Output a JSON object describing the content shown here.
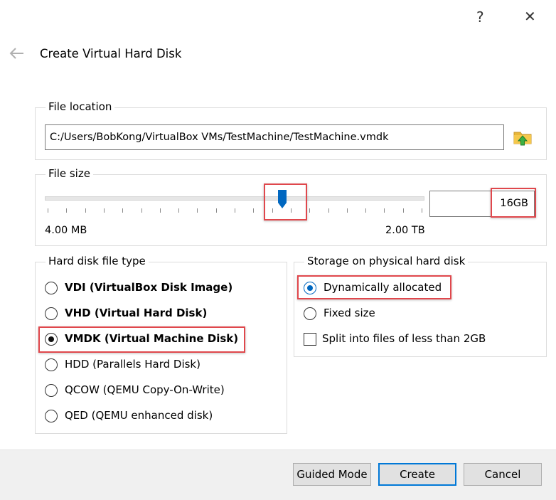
{
  "window": {
    "help_glyph": "?",
    "close_glyph": "✕",
    "title": "Create Virtual Hard Disk"
  },
  "file_location": {
    "group_label": "File location",
    "path": "C:/Users/BobKong/VirtualBox VMs/TestMachine/TestMachine.vmdk",
    "browse_icon": "folder-up-icon"
  },
  "file_size": {
    "group_label": "File size",
    "min_label": "4.00 MB",
    "max_label": "2.00 TB",
    "value": "16GB",
    "slider_fraction": 0.625
  },
  "disk_type": {
    "group_label": "Hard disk file type",
    "options": [
      {
        "label": "VDI (VirtualBox Disk Image)",
        "checked": false,
        "bold": true
      },
      {
        "label": "VHD (Virtual Hard Disk)",
        "checked": false,
        "bold": true
      },
      {
        "label": "VMDK (Virtual Machine Disk)",
        "checked": true,
        "bold": true
      },
      {
        "label": "HDD (Parallels Hard Disk)",
        "checked": false,
        "bold": false
      },
      {
        "label": "QCOW (QEMU Copy-On-Write)",
        "checked": false,
        "bold": false
      },
      {
        "label": "QED (QEMU enhanced disk)",
        "checked": false,
        "bold": false
      }
    ]
  },
  "storage": {
    "group_label": "Storage on physical hard disk",
    "dynamic_label": "Dynamically allocated",
    "fixed_label": "Fixed size",
    "split_label": "Split into files of less than 2GB",
    "dynamic_checked": true,
    "split_checked": false
  },
  "footer": {
    "guided_label": "Guided Mode",
    "create_label": "Create",
    "cancel_label": "Cancel"
  },
  "colors": {
    "highlight": "#e0474c",
    "accent": "#0067c0",
    "primary_border": "#0078d7"
  }
}
